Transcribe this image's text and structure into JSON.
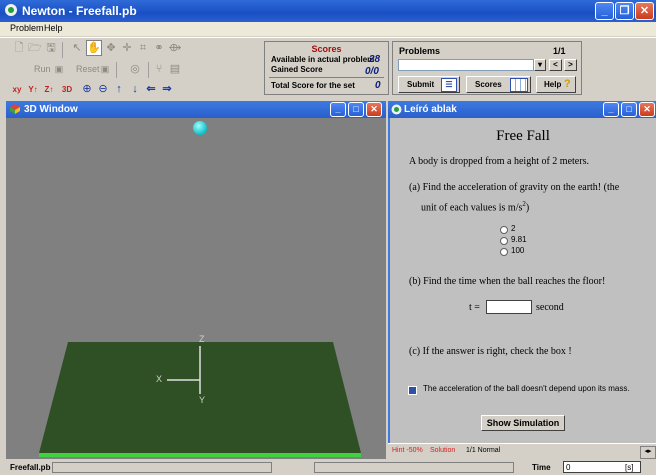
{
  "window": {
    "title": "Newton - Freefall.pb"
  },
  "menu": [
    "Problem",
    "Help"
  ],
  "toolbar": {
    "run_label": "Run",
    "reset_label": "Reset"
  },
  "scores": {
    "heading": "Scores",
    "available_label": "Available in actual problem",
    "available_value": "28",
    "gained_label": "Gained Score",
    "gained_value": "0/0",
    "total_label": "Total Score for the set",
    "total_value": "0"
  },
  "problems": {
    "heading": "Problems",
    "counter": "1/1",
    "prev_label": "<",
    "next_label": ">",
    "submit_label": "Submit",
    "scores_label": "Scores",
    "help_label": "Help",
    "help_mark": "?"
  },
  "win3d": {
    "title": "3D Window",
    "axis_x": "X",
    "axis_y": "Y",
    "axis_z": "Z",
    "colors": {
      "ball": "#20d8e0",
      "floor": "#2f4f24",
      "edge": "#40d040"
    }
  },
  "leiro": {
    "title": "Leíró ablak",
    "heading": "Free Fall",
    "intro": "A body is dropped from a height of 2 meters.",
    "q_a1": "(a) Find the acceleration of gravity on the earth! (the",
    "q_a2": "unit of each values is m/s",
    "q_a2_sup": "2",
    "q_a2_end": ")",
    "options": [
      "2",
      "9.81",
      "100"
    ],
    "q_b": "(b)   Find the time when the ball reaches the floor!",
    "t_label": "t =",
    "t_value": "",
    "t_unit": "second",
    "q_c": "(c) If the answer is right, check the box !",
    "checkbox_label": "The acceleration of the ball doesn't depend upon its mass.",
    "show_sim_label": "Show Simulation",
    "status_hint": "Hint -50%",
    "status_solution": "Solution",
    "status_mode": "1/1 Normal"
  },
  "status": {
    "file": "Freefall.pb",
    "time_label": "Time",
    "time_value": "0",
    "time_unit": "[s]"
  }
}
